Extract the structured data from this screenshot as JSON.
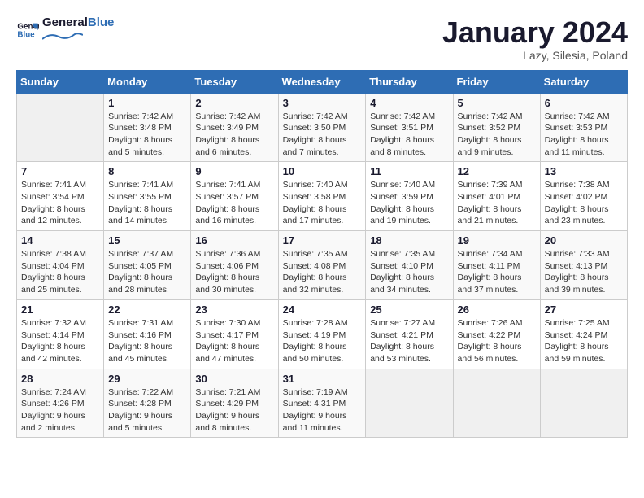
{
  "logo": {
    "text_general": "General",
    "text_blue": "Blue"
  },
  "title": "January 2024",
  "subtitle": "Lazy, Silesia, Poland",
  "days_header": [
    "Sunday",
    "Monday",
    "Tuesday",
    "Wednesday",
    "Thursday",
    "Friday",
    "Saturday"
  ],
  "weeks": [
    [
      {
        "day": "",
        "info": ""
      },
      {
        "day": "1",
        "info": "Sunrise: 7:42 AM\nSunset: 3:48 PM\nDaylight: 8 hours\nand 5 minutes."
      },
      {
        "day": "2",
        "info": "Sunrise: 7:42 AM\nSunset: 3:49 PM\nDaylight: 8 hours\nand 6 minutes."
      },
      {
        "day": "3",
        "info": "Sunrise: 7:42 AM\nSunset: 3:50 PM\nDaylight: 8 hours\nand 7 minutes."
      },
      {
        "day": "4",
        "info": "Sunrise: 7:42 AM\nSunset: 3:51 PM\nDaylight: 8 hours\nand 8 minutes."
      },
      {
        "day": "5",
        "info": "Sunrise: 7:42 AM\nSunset: 3:52 PM\nDaylight: 8 hours\nand 9 minutes."
      },
      {
        "day": "6",
        "info": "Sunrise: 7:42 AM\nSunset: 3:53 PM\nDaylight: 8 hours\nand 11 minutes."
      }
    ],
    [
      {
        "day": "7",
        "info": "Sunrise: 7:41 AM\nSunset: 3:54 PM\nDaylight: 8 hours\nand 12 minutes."
      },
      {
        "day": "8",
        "info": "Sunrise: 7:41 AM\nSunset: 3:55 PM\nDaylight: 8 hours\nand 14 minutes."
      },
      {
        "day": "9",
        "info": "Sunrise: 7:41 AM\nSunset: 3:57 PM\nDaylight: 8 hours\nand 16 minutes."
      },
      {
        "day": "10",
        "info": "Sunrise: 7:40 AM\nSunset: 3:58 PM\nDaylight: 8 hours\nand 17 minutes."
      },
      {
        "day": "11",
        "info": "Sunrise: 7:40 AM\nSunset: 3:59 PM\nDaylight: 8 hours\nand 19 minutes."
      },
      {
        "day": "12",
        "info": "Sunrise: 7:39 AM\nSunset: 4:01 PM\nDaylight: 8 hours\nand 21 minutes."
      },
      {
        "day": "13",
        "info": "Sunrise: 7:38 AM\nSunset: 4:02 PM\nDaylight: 8 hours\nand 23 minutes."
      }
    ],
    [
      {
        "day": "14",
        "info": "Sunrise: 7:38 AM\nSunset: 4:04 PM\nDaylight: 8 hours\nand 25 minutes."
      },
      {
        "day": "15",
        "info": "Sunrise: 7:37 AM\nSunset: 4:05 PM\nDaylight: 8 hours\nand 28 minutes."
      },
      {
        "day": "16",
        "info": "Sunrise: 7:36 AM\nSunset: 4:06 PM\nDaylight: 8 hours\nand 30 minutes."
      },
      {
        "day": "17",
        "info": "Sunrise: 7:35 AM\nSunset: 4:08 PM\nDaylight: 8 hours\nand 32 minutes."
      },
      {
        "day": "18",
        "info": "Sunrise: 7:35 AM\nSunset: 4:10 PM\nDaylight: 8 hours\nand 34 minutes."
      },
      {
        "day": "19",
        "info": "Sunrise: 7:34 AM\nSunset: 4:11 PM\nDaylight: 8 hours\nand 37 minutes."
      },
      {
        "day": "20",
        "info": "Sunrise: 7:33 AM\nSunset: 4:13 PM\nDaylight: 8 hours\nand 39 minutes."
      }
    ],
    [
      {
        "day": "21",
        "info": "Sunrise: 7:32 AM\nSunset: 4:14 PM\nDaylight: 8 hours\nand 42 minutes."
      },
      {
        "day": "22",
        "info": "Sunrise: 7:31 AM\nSunset: 4:16 PM\nDaylight: 8 hours\nand 45 minutes."
      },
      {
        "day": "23",
        "info": "Sunrise: 7:30 AM\nSunset: 4:17 PM\nDaylight: 8 hours\nand 47 minutes."
      },
      {
        "day": "24",
        "info": "Sunrise: 7:28 AM\nSunset: 4:19 PM\nDaylight: 8 hours\nand 50 minutes."
      },
      {
        "day": "25",
        "info": "Sunrise: 7:27 AM\nSunset: 4:21 PM\nDaylight: 8 hours\nand 53 minutes."
      },
      {
        "day": "26",
        "info": "Sunrise: 7:26 AM\nSunset: 4:22 PM\nDaylight: 8 hours\nand 56 minutes."
      },
      {
        "day": "27",
        "info": "Sunrise: 7:25 AM\nSunset: 4:24 PM\nDaylight: 8 hours\nand 59 minutes."
      }
    ],
    [
      {
        "day": "28",
        "info": "Sunrise: 7:24 AM\nSunset: 4:26 PM\nDaylight: 9 hours\nand 2 minutes."
      },
      {
        "day": "29",
        "info": "Sunrise: 7:22 AM\nSunset: 4:28 PM\nDaylight: 9 hours\nand 5 minutes."
      },
      {
        "day": "30",
        "info": "Sunrise: 7:21 AM\nSunset: 4:29 PM\nDaylight: 9 hours\nand 8 minutes."
      },
      {
        "day": "31",
        "info": "Sunrise: 7:19 AM\nSunset: 4:31 PM\nDaylight: 9 hours\nand 11 minutes."
      },
      {
        "day": "",
        "info": ""
      },
      {
        "day": "",
        "info": ""
      },
      {
        "day": "",
        "info": ""
      }
    ]
  ]
}
